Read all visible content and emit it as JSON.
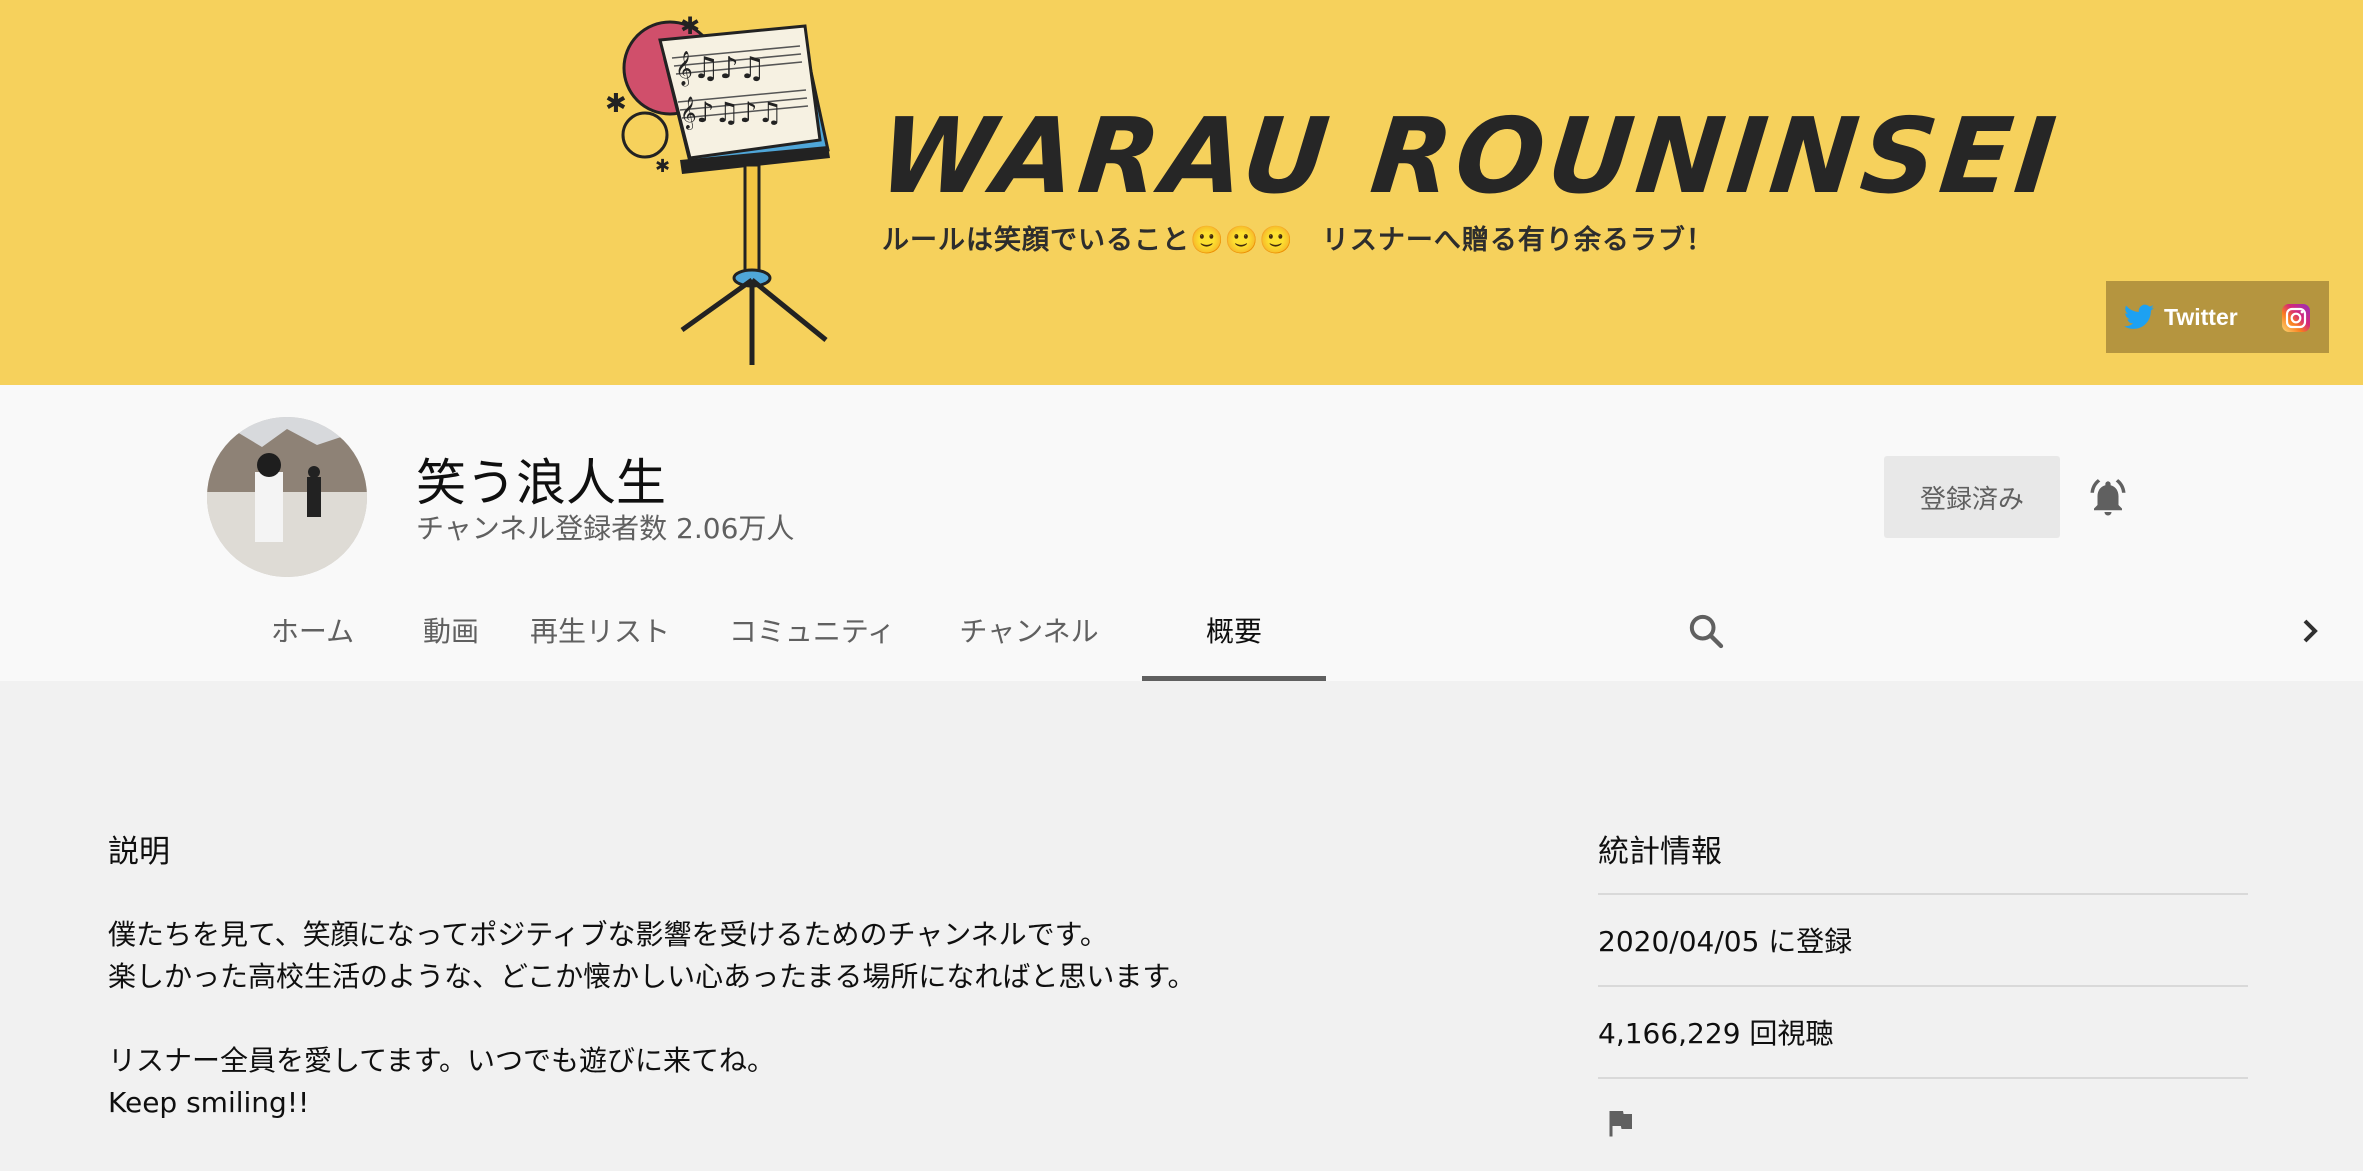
{
  "banner": {
    "title": "WARAU ROUNINSEI",
    "subtitle": "ルールは笑顔でいること🙂🙂🙂　リスナーへ贈る有り余るラブ！",
    "twitter_label": "Twitter",
    "instagram_icon": "instagram-icon",
    "twitter_icon": "twitter-bird-icon",
    "background_color": "#f6d15c",
    "social_bar_color": "#b5953f"
  },
  "channel": {
    "name": "笑う浪人生",
    "subscriber_text": "チャンネル登録者数 2.06万人",
    "subscribe_label": "登録済み",
    "bell_icon": "notification-bell-icon"
  },
  "tabs": [
    {
      "label": "ホーム"
    },
    {
      "label": "動画"
    },
    {
      "label": "再生リスト"
    },
    {
      "label": "コミュニティ"
    },
    {
      "label": "チャンネル"
    },
    {
      "label": "概要",
      "active": true
    }
  ],
  "about": {
    "description_title": "説明",
    "description_lines": [
      "僕たちを見て、笑顔になってポジティブな影響を受けるためのチャンネルです。",
      "楽しかった高校生活のような、どこか懐かしい心あったまる場所になればと思います。",
      "",
      "リスナー全員を愛してます。いつでも遊びに来てね。",
      "Keep smiling!!"
    ],
    "stats_title": "統計情報",
    "joined": "2020/04/05 に登録",
    "views": "4,166,229 回視聴",
    "flag_icon": "report-flag-icon"
  }
}
